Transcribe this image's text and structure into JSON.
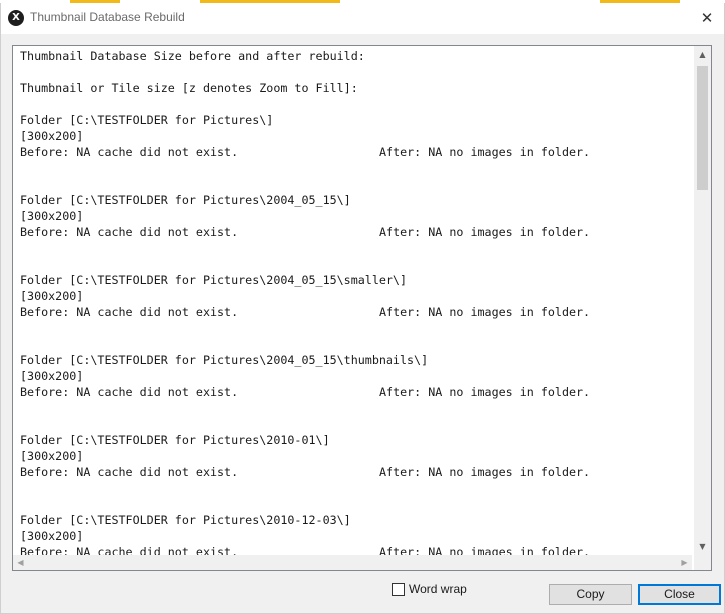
{
  "window": {
    "title": "Thumbnail Database Rebuild",
    "app_icon_glyph": "X",
    "close_glyph": "✕"
  },
  "colors": {
    "accent_yellow": "#f2b91a",
    "default_button_border": "#0078d7",
    "text_area_border": "#828790"
  },
  "log": {
    "header1": "Thumbnail Database Size before and after rebuild:",
    "header2": "Thumbnail or Tile size [z denotes Zoom to Fill]:",
    "entries": [
      {
        "folder": "Folder [C:\\TESTFOLDER for Pictures\\]",
        "size": "[300x200]",
        "before": "Before: NA cache did not exist.",
        "after": "After: NA no images in folder."
      },
      {
        "folder": "Folder [C:\\TESTFOLDER for Pictures\\2004_05_15\\]",
        "size": "[300x200]",
        "before": "Before: NA cache did not exist.",
        "after": "After: NA no images in folder."
      },
      {
        "folder": "Folder [C:\\TESTFOLDER for Pictures\\2004_05_15\\smaller\\]",
        "size": "[300x200]",
        "before": "Before: NA cache did not exist.",
        "after": "After: NA no images in folder."
      },
      {
        "folder": "Folder [C:\\TESTFOLDER for Pictures\\2004_05_15\\thumbnails\\]",
        "size": "[300x200]",
        "before": "Before: NA cache did not exist.",
        "after": "After: NA no images in folder."
      },
      {
        "folder": "Folder [C:\\TESTFOLDER for Pictures\\2010-01\\]",
        "size": "[300x200]",
        "before": "Before: NA cache did not exist.",
        "after": "After: NA no images in folder."
      },
      {
        "folder": "Folder [C:\\TESTFOLDER for Pictures\\2010-12-03\\]",
        "size": "[300x200]",
        "before": "Before: NA cache did not exist.",
        "after": "After: NA no images in folder."
      }
    ]
  },
  "scrollbars": {
    "up_arrow": "▲",
    "down_arrow": "▼",
    "left_arrow": "◀",
    "right_arrow": "▶"
  },
  "footer": {
    "word_wrap_label": "Word wrap",
    "word_wrap_checked": false,
    "copy_label": "Copy",
    "close_label": "Close"
  }
}
